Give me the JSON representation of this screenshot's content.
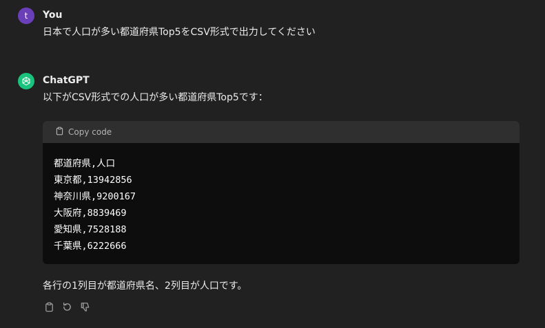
{
  "conversation": {
    "user": {
      "avatar_letter": "t",
      "name": "You",
      "message": "日本で人口が多い都道府県Top5をCSV形式で出力してください"
    },
    "assistant": {
      "name": "ChatGPT",
      "intro": "以下がCSV形式での人口が多い都道府県Top5です：",
      "code_block": {
        "copy_label": "Copy code",
        "lines": [
          "都道府県,人口",
          "東京都,13942856",
          "神奈川県,9200167",
          "大阪府,8839469",
          "愛知県,7528188",
          "千葉県,6222666"
        ]
      },
      "outro": "各行の1列目が都道府県名、2列目が人口です。",
      "actions": {
        "icons": [
          "clipboard-icon",
          "regenerate-icon",
          "thumbs-down-icon"
        ]
      }
    }
  },
  "colors": {
    "background": "#212121",
    "code_background": "#0d0d0d",
    "code_header": "#2f2f2f",
    "user_avatar": "#6b3fb8",
    "assistant_avatar": "#19c37d",
    "text": "#ececec",
    "muted": "#b4b4b4"
  }
}
